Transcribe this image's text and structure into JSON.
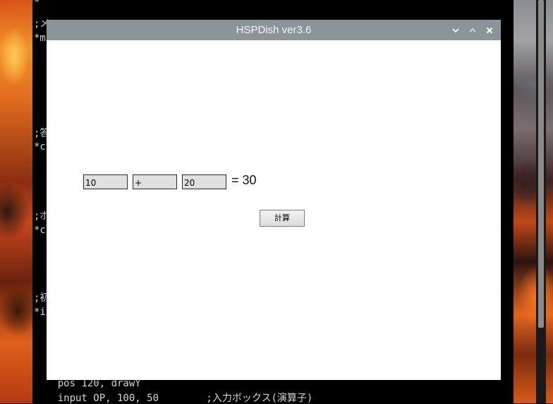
{
  "terminal": {
    "lines": [
      "s",
      ";メ",
      "*m",
      ";答",
      "*c",
      ";ボ",
      "*c",
      ";初",
      "*i",
      "    pos 120, drawY",
      "    input OP, 100, 50        ;入力ボックス(演算子)"
    ]
  },
  "window": {
    "title": "HSPDish ver3.6",
    "controls": [
      "chevron-down-icon",
      "chevron-up-icon",
      "close-icon"
    ]
  },
  "calculator": {
    "operand1": "10",
    "operator": "+",
    "operand2": "20",
    "result": "= 30",
    "button_label": "計算"
  },
  "colors": {
    "titlebar": "#8c949b",
    "input_bg": "#e0e0e0",
    "terminal_bg": "#000000"
  }
}
